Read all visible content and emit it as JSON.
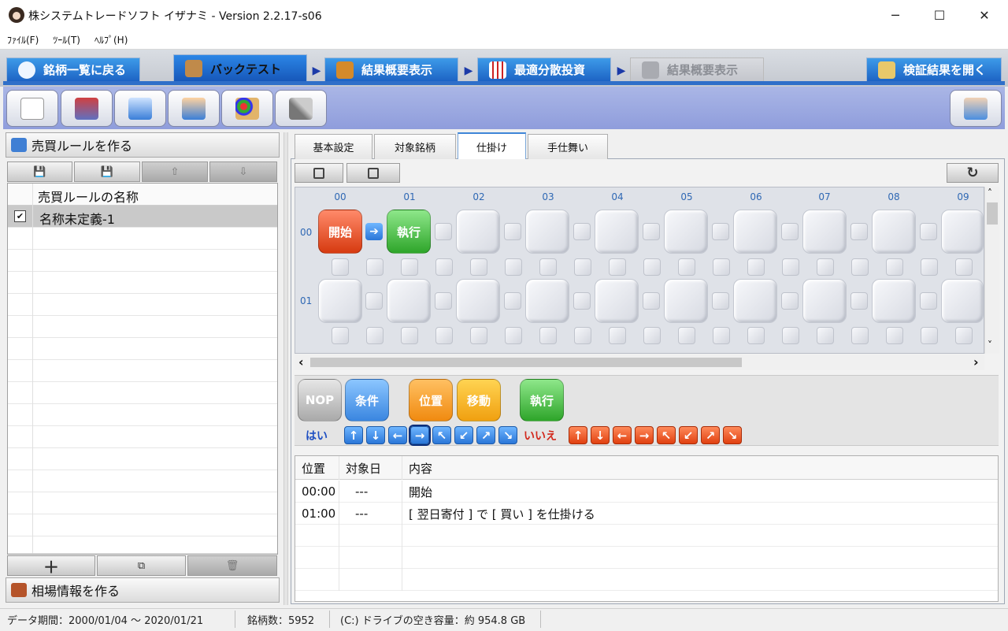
{
  "window": {
    "title": "株システムトレードソフト イザナミ - Version 2.2.17-s06",
    "minimize_glyph": "─",
    "maximize_glyph": "☐",
    "close_glyph": "✕"
  },
  "menu": [
    "ﾌｧｲﾙ(F)",
    "ﾂｰﾙ(T)",
    "ﾍﾙﾌﾟ(H)"
  ],
  "main_tabs": {
    "back": "銘柄一覧に戻る",
    "backtest": "バックテスト",
    "summary1": "結果概要表示",
    "portfolio": "最適分散投資",
    "summary2": "結果概要表示",
    "open_result": "検証結果を開く",
    "arrow_glyph": "▶"
  },
  "toolbar_icons": [
    "new-document-icon",
    "toolbox-icon",
    "export-icon",
    "import-icon",
    "palette-icon",
    "tools-icon",
    "hand-icon"
  ],
  "left": {
    "rule_header": "売買ルールを作る",
    "save_glyph": "💾",
    "up_glyph": "⇧",
    "down_glyph": "⇩",
    "column_header": "売買ルールの名称",
    "rules": [
      {
        "checked": true,
        "check_glyph": "✔",
        "name": "名称未定義-1"
      }
    ],
    "add_glyph": "＋",
    "copy_glyph": "⧉",
    "delete_glyph": "🗑",
    "market_header": "相場情報を作る"
  },
  "sub_tabs": [
    "基本設定",
    "対象銘柄",
    "仕掛け",
    "手仕舞い"
  ],
  "active_sub_tab": 2,
  "editor": {
    "refresh_glyph": "↻",
    "col_headers": [
      "00",
      "01",
      "02",
      "03",
      "04",
      "05",
      "06",
      "07",
      "08",
      "09"
    ],
    "row_headers": [
      "00",
      "01"
    ],
    "blocks": {
      "start": "開始",
      "execute": "執行",
      "link_arrow": "➔"
    },
    "scroll_left": "‹",
    "scroll_right": "›",
    "scroll_up": "˄",
    "scroll_down": "˅"
  },
  "palette": {
    "nop": "NOP",
    "cond": "条件",
    "position": "位置",
    "move": "移動",
    "execute": "執行",
    "yes": "はい",
    "no": "いいえ",
    "arrows": [
      "↑",
      "↓",
      "←",
      "→",
      "↖",
      "↙",
      "↗",
      "↘"
    ]
  },
  "detail": {
    "headers": [
      "位置",
      "対象日",
      "内容"
    ],
    "rows": [
      {
        "pos": "00:00",
        "date": "---",
        "content": "開始"
      },
      {
        "pos": "01:00",
        "date": "---",
        "content": "[ 翌日寄付 ] で [ 買い ] を仕掛ける"
      }
    ]
  },
  "status": {
    "period": "データ期間：2000/01/04 〜 2020/01/21",
    "count": "銘柄数：5952",
    "disk": "(C:) ドライブの空き容量：約 954.8 GB"
  }
}
